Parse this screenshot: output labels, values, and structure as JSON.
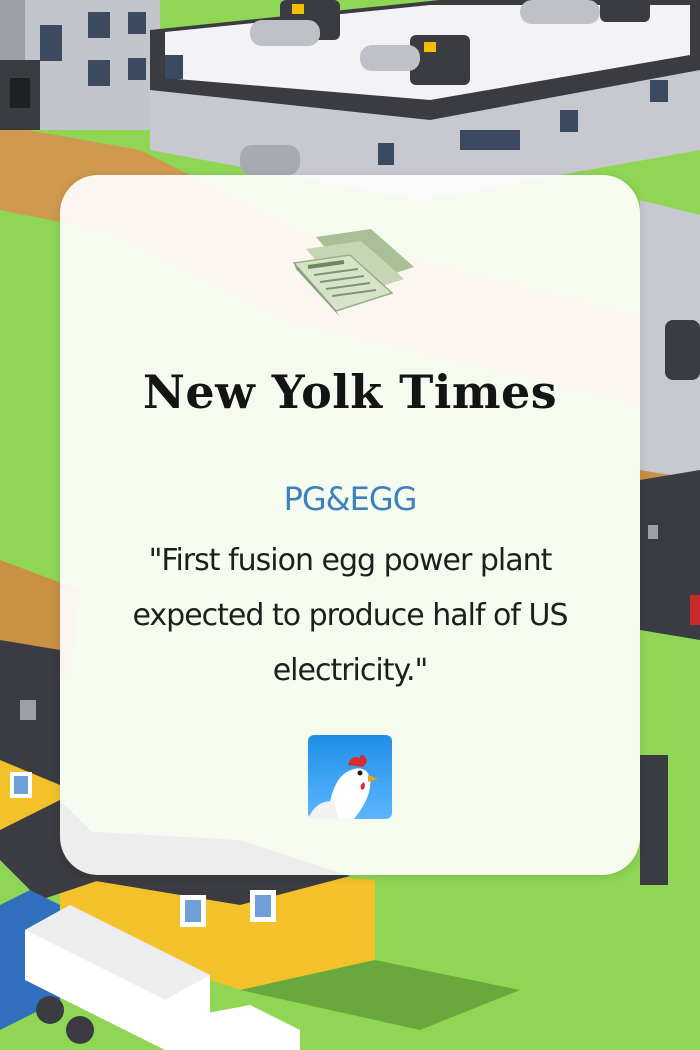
{
  "newspaper": {
    "masthead": "New Yolk Times",
    "company": "PG&EGG",
    "headline": "\"First fusion egg power plant expected to produce half of US electricity.\"",
    "icon": "newspaper-icon"
  },
  "app": {
    "icon": "chicken-app-icon"
  },
  "colors": {
    "grass": "#8fd655",
    "company_text": "#3d82bf",
    "card_background": "#ffffff",
    "road": "#cf9a50",
    "house_yellow": "#f3c12a"
  }
}
